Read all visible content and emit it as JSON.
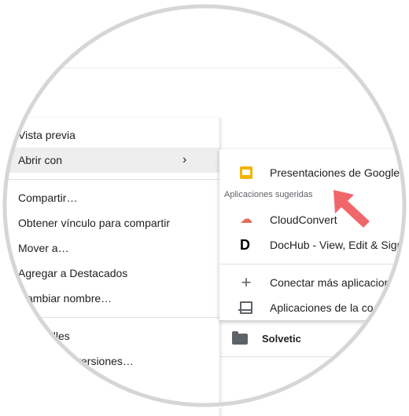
{
  "context_menu": {
    "items": [
      {
        "label": "Vista previa"
      },
      {
        "label": "Abrir con"
      },
      {
        "label": "Compartir…"
      },
      {
        "label": "Obtener vínculo para compartir"
      },
      {
        "label": "Mover a…"
      },
      {
        "label": "Agregar a Destacados"
      },
      {
        "label": "ambiar nombre…"
      },
      {
        "label": "alles"
      },
      {
        "label": "versiones…"
      }
    ],
    "submenu_chevron": "chevron-right-icon"
  },
  "open_with_submenu": {
    "primary_app": {
      "label": "Presentaciones de Google",
      "icon": "google-slides-icon"
    },
    "suggested_heading": "Aplicaciones sugeridas",
    "suggested": [
      {
        "label": "CloudConvert",
        "icon": "cloudconvert-icon"
      },
      {
        "label": "DocHub - View, Edit & Sign",
        "icon": "dochub-icon"
      }
    ],
    "actions": [
      {
        "label": "Conectar más aplicacion",
        "icon": "plus-icon"
      },
      {
        "label": "Aplicaciones de la co",
        "icon": "laptop-icon"
      }
    ]
  },
  "file_list": {
    "row_name": "Solvetic"
  },
  "colors": {
    "menu_highlight": "#eeeeee",
    "slides_yellow": "#f4b400",
    "annotation_arrow": "#f0676b",
    "vignette_ring": "#d6d6d6"
  }
}
